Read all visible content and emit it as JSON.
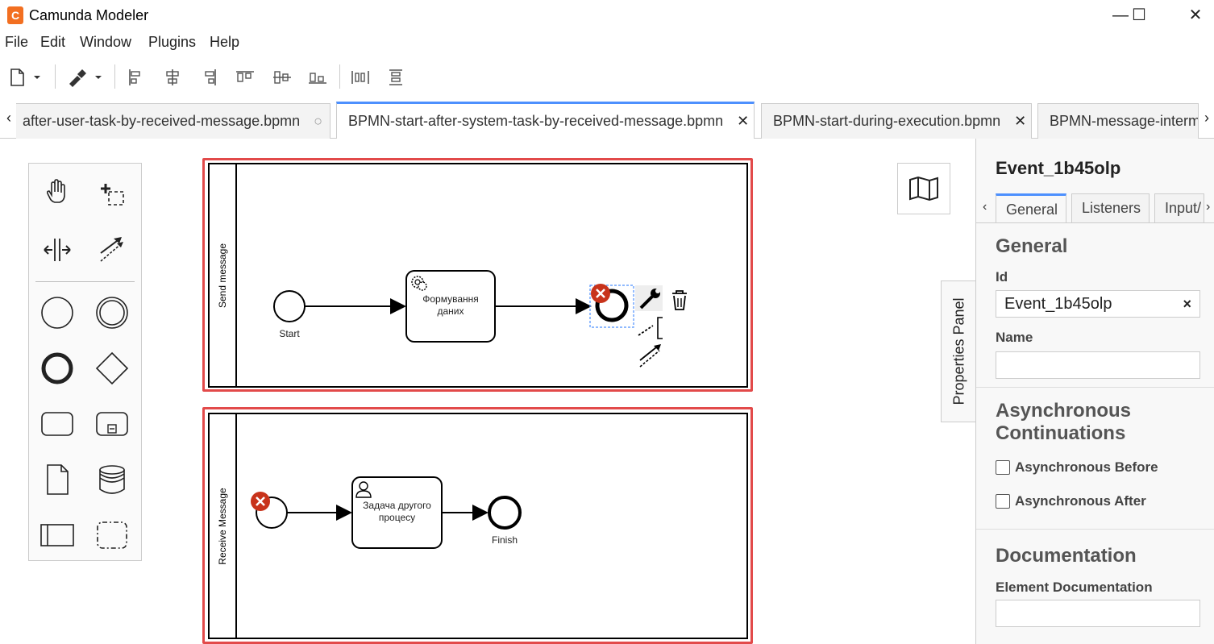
{
  "window": {
    "title": "Camunda Modeler",
    "app_icon_letter": "C",
    "minimize": "—",
    "maximize": "☐",
    "close": "✕"
  },
  "menu": [
    "File",
    "Edit",
    "Window",
    "Plugins",
    "Help"
  ],
  "tabs": [
    {
      "label": "after-user-task-by-received-message.bpmn",
      "state": "clean"
    },
    {
      "label": "BPMN-start-after-system-task-by-received-message.bpmn",
      "state": "active"
    },
    {
      "label": "BPMN-start-during-execution.bpmn",
      "state": "open"
    },
    {
      "label": "BPMN-message-interm",
      "state": "open"
    }
  ],
  "tab_nav": {
    "left": "‹",
    "right": "›"
  },
  "diagram": {
    "pools": [
      {
        "name": "Send message"
      },
      {
        "name": "Receive Message"
      }
    ],
    "elements": {
      "start_label": "Start",
      "task1_label": "Формування даних",
      "task2_label": "Задача другого процесу",
      "finish_label": "Finish"
    }
  },
  "properties_toggle": "Properties Panel",
  "properties": {
    "title": "Event_1b45olp",
    "tabs": [
      "General",
      "Listeners",
      "Input/"
    ],
    "tab_nav": {
      "left": "‹",
      "right": "›"
    },
    "general_heading": "General",
    "id_label": "Id",
    "id_value": "Event_1b45olp",
    "id_clear": "×",
    "name_label": "Name",
    "async_heading_line1": "Asynchronous",
    "async_heading_line2": "Continuations",
    "async_before": "Asynchronous Before",
    "async_after": "Asynchronous After",
    "doc_heading": "Documentation",
    "doc_label": "Element Documentation"
  },
  "colors": {
    "accent_blue": "#4d90fe",
    "selection_red": "#e24a4a",
    "error_red": "#c8331b",
    "app_orange": "#f26f21"
  }
}
